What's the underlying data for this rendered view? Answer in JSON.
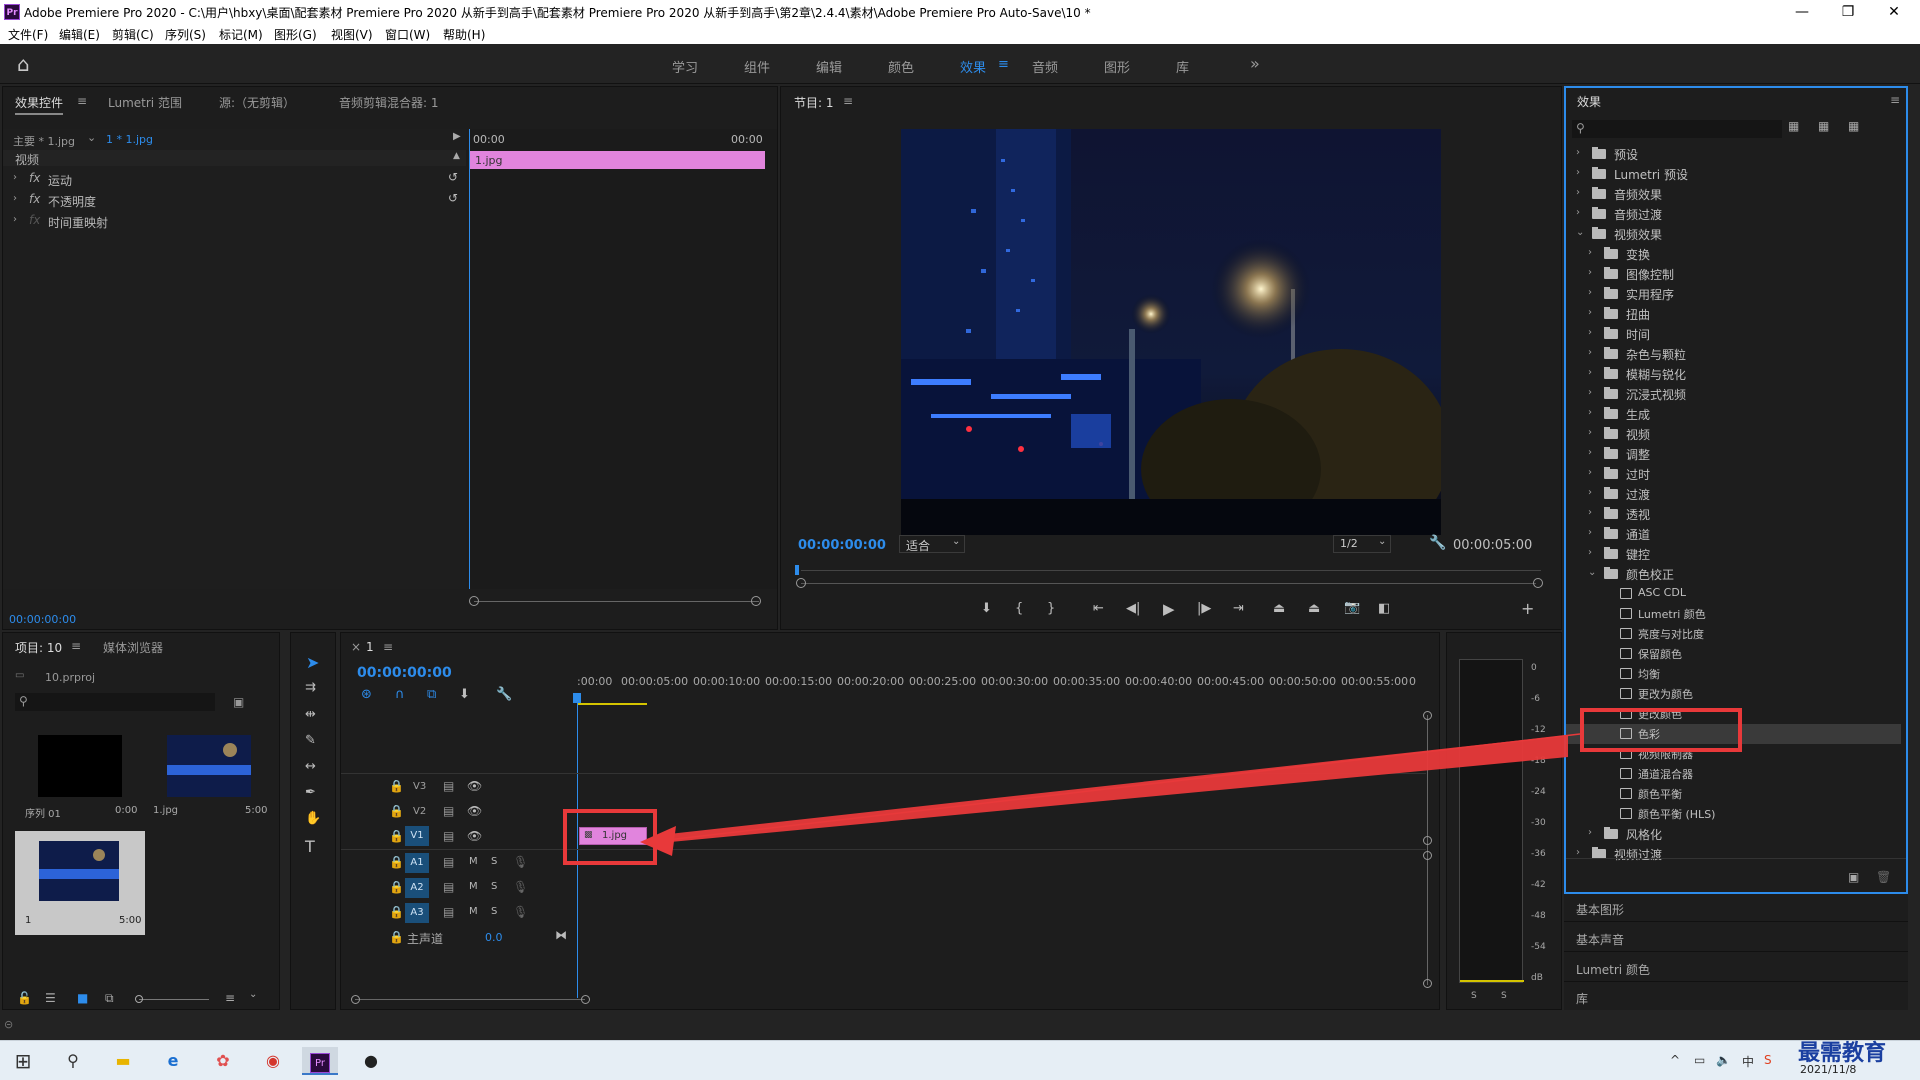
{
  "window": {
    "title": "Adobe Premiere Pro 2020 - C:\\用户\\hbxy\\桌面\\配套素材 Premiere Pro 2020 从新手到高手\\配套素材 Premiere Pro 2020 从新手到高手\\第2章\\2.4.4\\素材\\Adobe Premiere Pro Auto-Save\\10 *",
    "app_icon": "Pr",
    "minimize": "—",
    "maximize": "❐",
    "close": "✕"
  },
  "menu": [
    "文件(F)",
    "编辑(E)",
    "剪辑(C)",
    "序列(S)",
    "标记(M)",
    "图形(G)",
    "视图(V)",
    "窗口(W)",
    "帮助(H)"
  ],
  "workspaces": {
    "home_icon": "⌂",
    "items": [
      "学习",
      "组件",
      "编辑",
      "颜色",
      "效果",
      "音频",
      "图形",
      "库"
    ],
    "active": "效果",
    "menu_glyph": "≡",
    "more": "»"
  },
  "effect_controls": {
    "tabs": [
      "效果控件",
      "Lumetri 范围",
      "源:（无剪辑）",
      "音频剪辑混合器: 1"
    ],
    "tab_menu": "≡",
    "master_label": "主要 * 1.jpg",
    "clip_label": "1 * 1.jpg",
    "time_start": "00:00",
    "time_end": "00:00",
    "section": "视频",
    "props": [
      "运动",
      "不透明度",
      "时间重映射"
    ],
    "fx": "fx",
    "clip_bar": "1.jpg",
    "timecode": "00:00:00:00"
  },
  "program_monitor": {
    "tab": "节目: 1",
    "tab_menu": "≡",
    "timecode": "00:00:00:00",
    "fit": "适合",
    "resolution": "1/2",
    "duration": "00:00:05:00"
  },
  "project": {
    "tabs": [
      "项目: 10",
      "媒体浏览器"
    ],
    "tab_menu": "≡",
    "file": "10.prproj",
    "items": [
      {
        "name": "序列 01",
        "dur": "0:00"
      },
      {
        "name": "1.jpg",
        "dur": "5:00"
      },
      {
        "name": "1",
        "dur": "5:00"
      }
    ]
  },
  "timeline": {
    "tab": "1",
    "close": "×",
    "tab_menu": "≡",
    "timecode": "00:00:00:00",
    "ticks": [
      ":00:00",
      "00:00:05:00",
      "00:00:10:00",
      "00:00:15:00",
      "00:00:20:00",
      "00:00:25:00",
      "00:00:30:00",
      "00:00:35:00",
      "00:00:40:00",
      "00:00:45:00",
      "00:00:50:00",
      "00:00:55:00",
      "0"
    ],
    "video_tracks": [
      "V3",
      "V2",
      "V1"
    ],
    "audio_tracks": [
      "A1",
      "A2",
      "A3"
    ],
    "master": "主声道",
    "master_val": "0.0",
    "clip": "1.jpg",
    "m": "M",
    "s": "S"
  },
  "meter": {
    "labels": [
      "0",
      "-6",
      "-12",
      "-18",
      "-24",
      "-30",
      "-36",
      "-42",
      "-48",
      "-54",
      "dB"
    ],
    "solo": [
      "S",
      "S"
    ]
  },
  "effects": {
    "tab": "效果",
    "tab_menu": "≡",
    "tree": [
      {
        "label": "预设",
        "level": 0,
        "type": "folder",
        "open": false
      },
      {
        "label": "Lumetri 预设",
        "level": 0,
        "type": "folder",
        "open": false
      },
      {
        "label": "音频效果",
        "level": 0,
        "type": "folder",
        "open": false
      },
      {
        "label": "音频过渡",
        "level": 0,
        "type": "folder",
        "open": false
      },
      {
        "label": "视频效果",
        "level": 0,
        "type": "folder",
        "open": true
      },
      {
        "label": "变换",
        "level": 1,
        "type": "folder",
        "open": false
      },
      {
        "label": "图像控制",
        "level": 1,
        "type": "folder",
        "open": false
      },
      {
        "label": "实用程序",
        "level": 1,
        "type": "folder",
        "open": false
      },
      {
        "label": "扭曲",
        "level": 1,
        "type": "folder",
        "open": false
      },
      {
        "label": "时间",
        "level": 1,
        "type": "folder",
        "open": false
      },
      {
        "label": "杂色与颗粒",
        "level": 1,
        "type": "folder",
        "open": false
      },
      {
        "label": "模糊与锐化",
        "level": 1,
        "type": "folder",
        "open": false
      },
      {
        "label": "沉浸式视频",
        "level": 1,
        "type": "folder",
        "open": false
      },
      {
        "label": "生成",
        "level": 1,
        "type": "folder",
        "open": false
      },
      {
        "label": "视频",
        "level": 1,
        "type": "folder",
        "open": false
      },
      {
        "label": "调整",
        "level": 1,
        "type": "folder",
        "open": false
      },
      {
        "label": "过时",
        "level": 1,
        "type": "folder",
        "open": false
      },
      {
        "label": "过渡",
        "level": 1,
        "type": "folder",
        "open": false
      },
      {
        "label": "透视",
        "level": 1,
        "type": "folder",
        "open": false
      },
      {
        "label": "通道",
        "level": 1,
        "type": "folder",
        "open": false
      },
      {
        "label": "键控",
        "level": 1,
        "type": "folder",
        "open": false
      },
      {
        "label": "颜色校正",
        "level": 1,
        "type": "folder",
        "open": true
      },
      {
        "label": "ASC CDL",
        "level": 2,
        "type": "effect"
      },
      {
        "label": "Lumetri 颜色",
        "level": 2,
        "type": "effect"
      },
      {
        "label": "亮度与对比度",
        "level": 2,
        "type": "effect"
      },
      {
        "label": "保留颜色",
        "level": 2,
        "type": "effect"
      },
      {
        "label": "均衡",
        "level": 2,
        "type": "effect"
      },
      {
        "label": "更改为颜色",
        "level": 2,
        "type": "effect"
      },
      {
        "label": "更改颜色",
        "level": 2,
        "type": "effect"
      },
      {
        "label": "色彩",
        "level": 2,
        "type": "effect",
        "selected": true
      },
      {
        "label": "视频限制器",
        "level": 2,
        "type": "effect"
      },
      {
        "label": "通道混合器",
        "level": 2,
        "type": "effect"
      },
      {
        "label": "颜色平衡",
        "level": 2,
        "type": "effect"
      },
      {
        "label": "颜色平衡 (HLS)",
        "level": 2,
        "type": "effect"
      },
      {
        "label": "风格化",
        "level": 1,
        "type": "folder",
        "open": false
      },
      {
        "label": "视频过渡",
        "level": 0,
        "type": "folder",
        "open": false
      }
    ],
    "bottom_panels": [
      "基本图形",
      "基本声音",
      "Lumetri 颜色",
      "库"
    ]
  },
  "taskbar": {
    "start": "⊞",
    "search": "⚲",
    "ime": "中",
    "time": "2021/11/8",
    "watermark": "最需教育"
  },
  "colors": {
    "accent": "#2d8ceb",
    "clip": "#e184dd",
    "highlight": "#e8393a"
  }
}
